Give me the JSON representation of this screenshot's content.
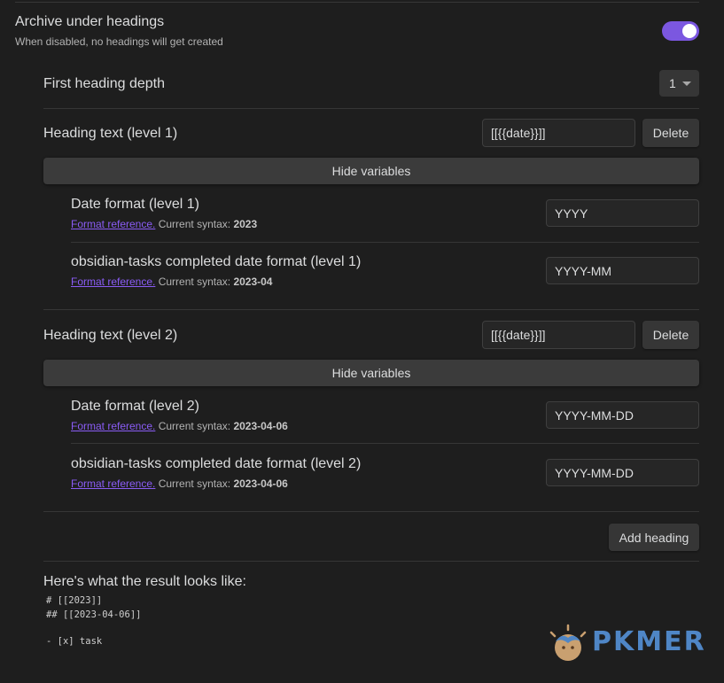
{
  "archive": {
    "title": "Archive under headings",
    "description": "When disabled, no headings will get created",
    "enabled": true
  },
  "depth": {
    "title": "First heading depth",
    "value": "1"
  },
  "headings": [
    {
      "title": "Heading text (level 1)",
      "value": "[[{{date}}]]",
      "delete_label": "Delete",
      "toggle_label": "Hide variables",
      "variables": [
        {
          "title": "Date format (level 1)",
          "link": "Format reference.",
          "syntax_label": "Current syntax:",
          "syntax_value": "2023",
          "value": "YYYY"
        },
        {
          "title": "obsidian-tasks completed date format (level 1)",
          "link": "Format reference.",
          "syntax_label": "Current syntax:",
          "syntax_value": "2023-04",
          "value": "YYYY-MM"
        }
      ]
    },
    {
      "title": "Heading text (level 2)",
      "value": "[[{{date}}]]",
      "delete_label": "Delete",
      "toggle_label": "Hide variables",
      "variables": [
        {
          "title": "Date format (level 2)",
          "link": "Format reference.",
          "syntax_label": "Current syntax:",
          "syntax_value": "2023-04-06",
          "value": "YYYY-MM-DD"
        },
        {
          "title": "obsidian-tasks completed date format (level 2)",
          "link": "Format reference.",
          "syntax_label": "Current syntax:",
          "syntax_value": "2023-04-06",
          "value": "YYYY-MM-DD"
        }
      ]
    }
  ],
  "add_heading_label": "Add heading",
  "preview": {
    "title": "Here's what the result looks like:",
    "lines": [
      "# [[2023]]",
      "## [[2023-04-06]]",
      "",
      "- [x] task"
    ]
  },
  "logo": {
    "text": "PKMER",
    "colors": {
      "main": "#4f86c6",
      "icon": "#c9a070"
    }
  },
  "colors": {
    "background": "#1e1e1e",
    "accent": "#7b57e0",
    "link": "#8a5cf5"
  }
}
